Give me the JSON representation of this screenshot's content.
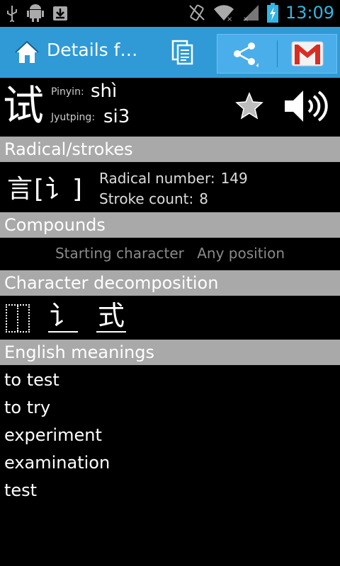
{
  "statusbar": {
    "time": "13:09",
    "icons": [
      "usb-icon",
      "android-debug-icon",
      "download-icon",
      "vibrate-icon",
      "wifi-icon",
      "signal-icon",
      "battery-charging-icon"
    ]
  },
  "actionbar": {
    "title": "Details f…",
    "icons": [
      "home-icon",
      "copy-icon",
      "share-icon",
      "gmail-icon"
    ]
  },
  "entry": {
    "character": "试",
    "pinyin_label": "Pinyin:",
    "pinyin": "shì",
    "jyutping_label": "Jyutping:",
    "jyutping": "si3"
  },
  "radical": {
    "header": "Radical/strokes",
    "chars": "言[讠]",
    "number_label": "Radical number:",
    "number": "149",
    "strokes_label": "Stroke count:",
    "strokes": "8"
  },
  "compounds": {
    "header": "Compounds",
    "starting": "Starting character",
    "any": "Any position"
  },
  "decomposition": {
    "header": "Character decomposition",
    "components": [
      "讠",
      "式"
    ]
  },
  "meanings": {
    "header": "English meanings",
    "items": [
      "to test",
      "to try",
      "experiment",
      "examination",
      "test"
    ]
  }
}
